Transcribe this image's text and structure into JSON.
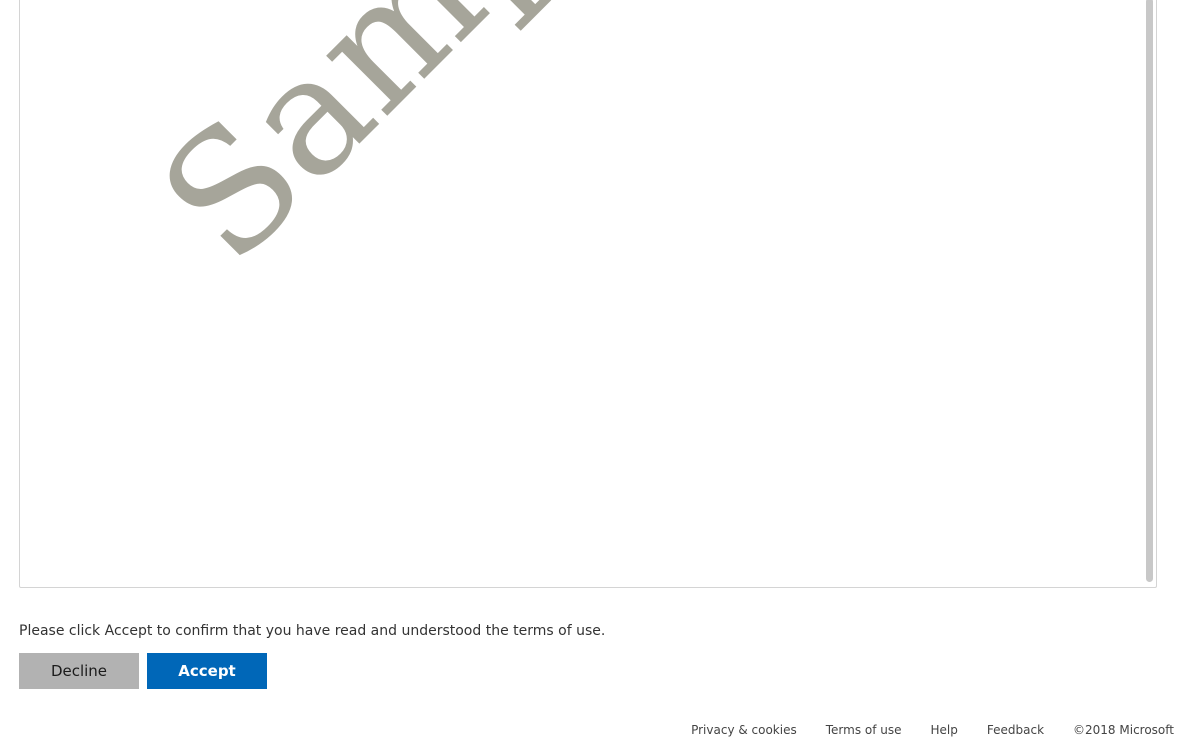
{
  "document": {
    "watermark_text": "Sample",
    "watermark_color": "#a6a59a"
  },
  "consent": {
    "message": "Please click Accept to confirm that you have read and understood the terms of use.",
    "decline_label": "Decline",
    "accept_label": "Accept",
    "accent_color": "#0067b8"
  },
  "footer": {
    "links": [
      {
        "label": "Privacy & cookies"
      },
      {
        "label": "Terms of use"
      },
      {
        "label": "Help"
      },
      {
        "label": "Feedback"
      }
    ],
    "copyright": "©2018 Microsoft"
  }
}
